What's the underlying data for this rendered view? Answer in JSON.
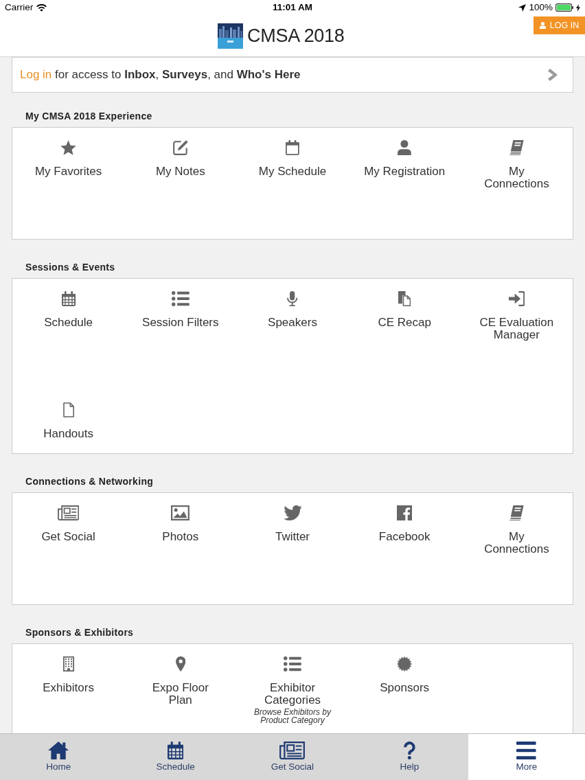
{
  "status_bar": {
    "carrier": "Carrier",
    "time": "11:01 AM",
    "battery": "100%"
  },
  "header": {
    "title": "CMSA 2018",
    "login_button": "LOG IN"
  },
  "login_banner": {
    "link": "Log in",
    "text": "for access to **Inbox**, **Surveys**, and **Who's Here**"
  },
  "sections": [
    {
      "title": "My CMSA 2018 Experience",
      "items": [
        {
          "label": "My Favorites"
        },
        {
          "label": "My Notes"
        },
        {
          "label": "My Schedule"
        },
        {
          "label": "My Registration"
        },
        {
          "label": "My\nConnections"
        }
      ]
    },
    {
      "title": "Sessions & Events",
      "items": [
        {
          "label": "Schedule"
        },
        {
          "label": "Session Filters"
        },
        {
          "label": "Speakers"
        },
        {
          "label": "CE Recap"
        },
        {
          "label": "CE Evaluation\nManager"
        },
        {
          "label": "Handouts"
        }
      ]
    },
    {
      "title": "Connections & Networking",
      "items": [
        {
          "label": "Get Social"
        },
        {
          "label": "Photos"
        },
        {
          "label": "Twitter"
        },
        {
          "label": "Facebook"
        },
        {
          "label": "My\nConnections"
        }
      ]
    },
    {
      "title": "Sponsors & Exhibitors",
      "items": [
        {
          "label": "Exhibitors"
        },
        {
          "label": "Expo Floor\nPlan"
        },
        {
          "label": "Exhibitor\nCategories",
          "subtitle": "Browse Exhibitors by\nProduct Category"
        },
        {
          "label": "Sponsors"
        }
      ]
    }
  ],
  "tab_bar": [
    {
      "label": "Home",
      "selected": false
    },
    {
      "label": "Schedule",
      "selected": false
    },
    {
      "label": "Get Social",
      "selected": false
    },
    {
      "label": "Help",
      "selected": false
    },
    {
      "label": "More",
      "selected": true
    }
  ]
}
